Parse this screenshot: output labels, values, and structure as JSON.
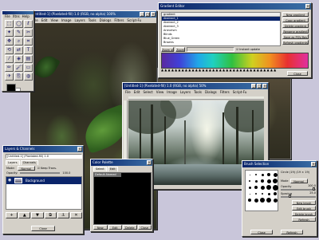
{
  "toolbox": {
    "title": "",
    "menu": [
      "File",
      "Xtns",
      "Help"
    ],
    "tools": [
      {
        "icon": "rect-select-icon",
        "glyph": "⬚"
      },
      {
        "icon": "ellipse-select-icon",
        "glyph": "◯"
      },
      {
        "icon": "lasso-icon",
        "glyph": "ℓ"
      },
      {
        "icon": "magic-wand-icon",
        "glyph": "✦"
      },
      {
        "icon": "bezier-icon",
        "glyph": "✎"
      },
      {
        "icon": "scissors-icon",
        "glyph": "✂"
      },
      {
        "icon": "move-icon",
        "glyph": "✥"
      },
      {
        "icon": "magnify-icon",
        "glyph": "⌕"
      },
      {
        "icon": "crop-icon",
        "glyph": "⌗"
      },
      {
        "icon": "transform-icon",
        "glyph": "⟲"
      },
      {
        "icon": "flip-icon",
        "glyph": "⇄"
      },
      {
        "icon": "text-icon",
        "glyph": "T"
      },
      {
        "icon": "color-picker-icon",
        "glyph": "⁄"
      },
      {
        "icon": "bucket-fill-icon",
        "glyph": "◈"
      },
      {
        "icon": "blend-icon",
        "glyph": "▤"
      },
      {
        "icon": "pencil-icon",
        "glyph": "✏"
      },
      {
        "icon": "paintbrush-icon",
        "glyph": "🖌"
      },
      {
        "icon": "eraser-icon",
        "glyph": "▭"
      },
      {
        "icon": "airbrush-icon",
        "glyph": "✈"
      },
      {
        "icon": "clone-icon",
        "glyph": "⎘"
      },
      {
        "icon": "blur-icon",
        "glyph": "◍"
      }
    ]
  },
  "bg_image_window": {
    "title": "[Untitled-1] (Pixelated-fill) 1.0 (RGB, no alpha) 100%",
    "menu": [
      "File",
      "Edit",
      "View",
      "Image",
      "Layers",
      "Tools",
      "Dialogs",
      "Filters",
      "Script-Fu"
    ]
  },
  "gradient_editor": {
    "title": "Gradient Editor",
    "list_header": "gradient",
    "gradients": [
      "Abstract_1",
      "Abstract_2",
      "Abstract_3",
      "Aneurism",
      "Blinds",
      "Blue_Green",
      "Browns"
    ],
    "selected_index": 0,
    "side_buttons": [
      "New gradient",
      "Copy gradient",
      "Delete gradient",
      "Rename gradient",
      "Save as POV-Ray",
      "Refresh gradients"
    ],
    "zoom_label": "Zoom all",
    "zoom_in": "Zoom",
    "instant_update": "Instant update",
    "close": "Close"
  },
  "image_window": {
    "title": "[Untitled-1] (Pixelated-fill) 1.0 (RGB, no alpha) 50%",
    "menu": [
      "File",
      "Edit",
      "Select",
      "View",
      "Image",
      "Layers",
      "Tools",
      "Dialogs",
      "Filters",
      "Script-Fu"
    ]
  },
  "layers": {
    "title": "Layers & Channels",
    "image_select": "[Untitled-1] (Pixelated-fill) 1.0",
    "tabs": [
      "Layers",
      "Channels"
    ],
    "mode_label": "Mode:",
    "mode_value": "Normal",
    "keep_trans": "Keep Trans.",
    "opacity_label": "Opacity:",
    "opacity_value": "100.0",
    "layer_name": "Background",
    "buttons": [
      "+",
      "▲",
      "▼",
      "⧉",
      "⚓",
      "✕"
    ],
    "close": "Close"
  },
  "palette": {
    "title": "Color Palette",
    "tabs": [
      "Select",
      "Edit"
    ],
    "selected": "Default-Named",
    "buttons": [
      "New",
      "Edit",
      "Delete",
      "Close"
    ]
  },
  "brush": {
    "title": "Brush Selection",
    "info": "Circle (19) (19 × 19)",
    "mode_label": "Mode",
    "mode_value": "Normal",
    "opacity_label": "Opacity",
    "opacity_value": "100.0",
    "spacing_label": "Spacing",
    "spacing_value": "25.0",
    "buttons": [
      "Refresh",
      "New brush",
      "Edit brush",
      "Delete brush"
    ],
    "right_buttons": [
      "Refresh",
      "Close"
    ],
    "sizes": [
      1,
      2,
      3,
      4,
      5,
      2,
      3,
      4,
      5,
      6,
      3,
      4,
      5,
      6,
      7,
      1,
      2,
      2,
      3,
      4,
      4,
      5,
      6,
      6,
      5
    ],
    "opacity": 1.0,
    "spacing": 0.25
  }
}
